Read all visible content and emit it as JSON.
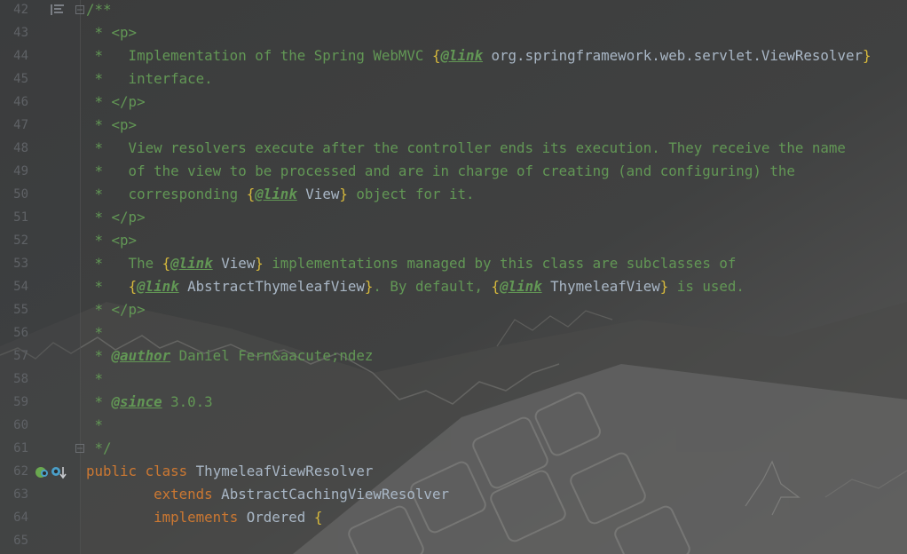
{
  "editor": {
    "lines": [
      {
        "n": "42",
        "segs": [
          {
            "t": "/**",
            "c": "comment"
          }
        ]
      },
      {
        "n": "43",
        "segs": [
          {
            "t": " * <p>",
            "c": "comment"
          }
        ]
      },
      {
        "n": "44",
        "segs": [
          {
            "t": " *   Implementation of the Spring WebMVC ",
            "c": "comment"
          },
          {
            "t": "{",
            "c": "brace"
          },
          {
            "t": "@link",
            "c": "tag"
          },
          {
            "t": " org.springframework.web.servlet.ViewResolver",
            "c": "ref"
          },
          {
            "t": "}",
            "c": "brace"
          }
        ]
      },
      {
        "n": "45",
        "segs": [
          {
            "t": " *   interface.",
            "c": "comment"
          }
        ]
      },
      {
        "n": "46",
        "segs": [
          {
            "t": " * </p>",
            "c": "comment"
          }
        ]
      },
      {
        "n": "47",
        "segs": [
          {
            "t": " * <p>",
            "c": "comment"
          }
        ]
      },
      {
        "n": "48",
        "segs": [
          {
            "t": " *   View resolvers execute after the controller ends its execution. They receive the name",
            "c": "comment"
          }
        ]
      },
      {
        "n": "49",
        "segs": [
          {
            "t": " *   of the view to be processed and are in charge of creating (and configuring) the",
            "c": "comment"
          }
        ]
      },
      {
        "n": "50",
        "segs": [
          {
            "t": " *   corresponding ",
            "c": "comment"
          },
          {
            "t": "{",
            "c": "brace"
          },
          {
            "t": "@link",
            "c": "tag"
          },
          {
            "t": " View",
            "c": "ref"
          },
          {
            "t": "}",
            "c": "brace"
          },
          {
            "t": " object for it.",
            "c": "comment"
          }
        ]
      },
      {
        "n": "51",
        "segs": [
          {
            "t": " * </p>",
            "c": "comment"
          }
        ]
      },
      {
        "n": "52",
        "segs": [
          {
            "t": " * <p>",
            "c": "comment"
          }
        ]
      },
      {
        "n": "53",
        "segs": [
          {
            "t": " *   The ",
            "c": "comment"
          },
          {
            "t": "{",
            "c": "brace"
          },
          {
            "t": "@link",
            "c": "tag"
          },
          {
            "t": " View",
            "c": "ref"
          },
          {
            "t": "}",
            "c": "brace"
          },
          {
            "t": " implementations managed by this class are subclasses of",
            "c": "comment"
          }
        ]
      },
      {
        "n": "54",
        "segs": [
          {
            "t": " *   ",
            "c": "comment"
          },
          {
            "t": "{",
            "c": "brace"
          },
          {
            "t": "@link",
            "c": "tag"
          },
          {
            "t": " AbstractThymeleafView",
            "c": "ref"
          },
          {
            "t": "}",
            "c": "brace"
          },
          {
            "t": ". By default, ",
            "c": "comment"
          },
          {
            "t": "{",
            "c": "brace"
          },
          {
            "t": "@link",
            "c": "tag"
          },
          {
            "t": " ThymeleafView",
            "c": "ref"
          },
          {
            "t": "}",
            "c": "brace"
          },
          {
            "t": " is used.",
            "c": "comment"
          }
        ]
      },
      {
        "n": "55",
        "segs": [
          {
            "t": " * </p>",
            "c": "comment"
          }
        ]
      },
      {
        "n": "56",
        "segs": [
          {
            "t": " *",
            "c": "comment"
          }
        ]
      },
      {
        "n": "57",
        "segs": [
          {
            "t": " * ",
            "c": "comment"
          },
          {
            "t": "@author",
            "c": "tag"
          },
          {
            "t": " Daniel Fern&aacute;ndez",
            "c": "comment"
          }
        ]
      },
      {
        "n": "58",
        "segs": [
          {
            "t": " *",
            "c": "comment"
          }
        ]
      },
      {
        "n": "59",
        "segs": [
          {
            "t": " * ",
            "c": "comment"
          },
          {
            "t": "@since",
            "c": "tag"
          },
          {
            "t": " 3.0.3",
            "c": "comment"
          }
        ]
      },
      {
        "n": "60",
        "segs": [
          {
            "t": " *",
            "c": "comment"
          }
        ]
      },
      {
        "n": "61",
        "segs": [
          {
            "t": " */",
            "c": "comment"
          }
        ]
      },
      {
        "n": "62",
        "segs": [
          {
            "t": "public",
            "c": "kw"
          },
          {
            "t": " ",
            "c": "cls"
          },
          {
            "t": "class",
            "c": "kw"
          },
          {
            "t": " ThymeleafViewResolver",
            "c": "cls"
          }
        ]
      },
      {
        "n": "63",
        "segs": [
          {
            "t": "        ",
            "c": "cls"
          },
          {
            "t": "extends",
            "c": "kw"
          },
          {
            "t": " AbstractCachingViewResolver",
            "c": "cls"
          }
        ]
      },
      {
        "n": "64",
        "segs": [
          {
            "t": "        ",
            "c": "cls"
          },
          {
            "t": "implements",
            "c": "kw"
          },
          {
            "t": " Ordered ",
            "c": "cls"
          },
          {
            "t": "{",
            "c": "brace"
          }
        ]
      },
      {
        "n": "65",
        "segs": []
      }
    ]
  },
  "gutter_icons": {
    "fold_top": "fold-icon",
    "structure": "structure-icon",
    "spring_bean": "spring-bean-icon",
    "implemented": "implemented-arrow-icon"
  },
  "colors": {
    "background": "#3c3d3d",
    "comment": "#629755",
    "keyword": "#cc7832",
    "identifier": "#a9b7c6",
    "brace": "#d6b93c",
    "line_number": "#5f6266"
  }
}
